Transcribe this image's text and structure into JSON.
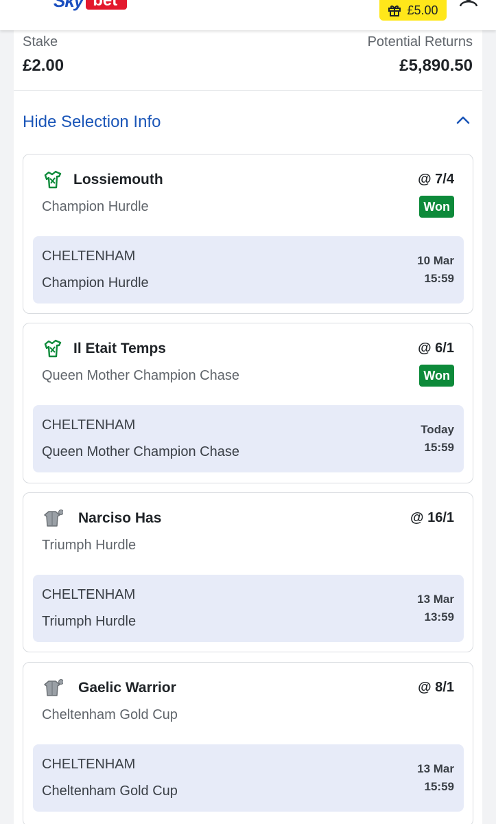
{
  "header": {
    "logo_sky": "Sky",
    "logo_bet": "bet",
    "bonus_amount": "£5.00",
    "menu_icon": "hamburger-icon",
    "account_icon": "user-icon",
    "gift_icon": "gift-icon",
    "colors": {
      "brand_blue": "#1b4fbf",
      "brand_red": "#e3182d",
      "bonus_yellow": "#ffe71a"
    }
  },
  "bet_summary": {
    "stake_label": "Stake",
    "stake_value": "£2.00",
    "returns_label": "Potential Returns",
    "returns_value": "£5,890.50"
  },
  "selection_info": {
    "toggle_label": "Hide Selection Info",
    "toggle_icon": "chevron-up-icon",
    "link_color": "#1b56b8"
  },
  "selections": [
    {
      "runner": "Lossiemouth",
      "race": "Champion Hurdle",
      "odds": "@ 7/4",
      "result": "Won",
      "silk_icon": "green-silk-icon",
      "venue": "CHELTENHAM",
      "event_race": "Champion Hurdle",
      "date": "10 Mar",
      "time": "15:59"
    },
    {
      "runner": "Il Etait Temps",
      "race": "Queen Mother Champion Chase",
      "odds": "@ 6/1",
      "result": "Won",
      "silk_icon": "green-silk-icon",
      "venue": "CHELTENHAM",
      "event_race": "Queen Mother Champion Chase",
      "date": "Today",
      "time": "15:59"
    },
    {
      "runner": "Narciso Has",
      "race": "Triumph Hurdle",
      "odds": "@ 16/1",
      "result": "",
      "silk_icon": "grey-silk-icon",
      "venue": "CHELTENHAM",
      "event_race": "Triumph Hurdle",
      "date": "13 Mar",
      "time": "13:59"
    },
    {
      "runner": "Gaelic Warrior",
      "race": "Cheltenham Gold Cup",
      "odds": "@ 8/1",
      "result": "",
      "silk_icon": "grey-silk-icon",
      "venue": "CHELTENHAM",
      "event_race": "Cheltenham Gold Cup",
      "date": "13 Mar",
      "time": "15:59"
    }
  ],
  "won_color": "#0d8a3a"
}
